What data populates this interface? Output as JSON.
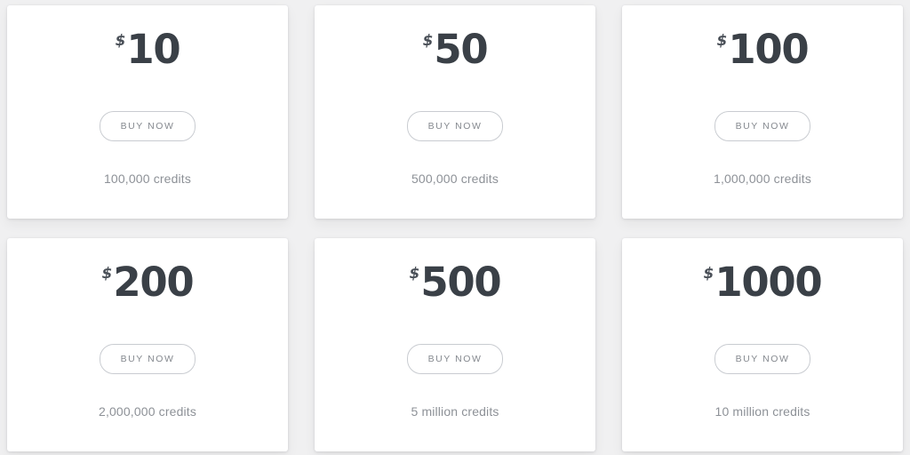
{
  "page": {
    "background_color": "#f0f0f1",
    "card_color": "#ffffff",
    "price_color": "#3a4047",
    "muted_text_color": "#8d9197",
    "button_border_color": "#c9ccd1"
  },
  "plans": [
    {
      "currency": "$",
      "amount": "10",
      "buy_label": "BUY NOW",
      "credits": "100,000 credits"
    },
    {
      "currency": "$",
      "amount": "50",
      "buy_label": "BUY NOW",
      "credits": "500,000 credits"
    },
    {
      "currency": "$",
      "amount": "100",
      "buy_label": "BUY NOW",
      "credits": "1,000,000 credits"
    },
    {
      "currency": "$",
      "amount": "200",
      "buy_label": "BUY NOW",
      "credits": "2,000,000 credits"
    },
    {
      "currency": "$",
      "amount": "500",
      "buy_label": "BUY NOW",
      "credits": "5 million credits"
    },
    {
      "currency": "$",
      "amount": "1000",
      "buy_label": "BUY NOW",
      "credits": "10 million credits"
    }
  ]
}
